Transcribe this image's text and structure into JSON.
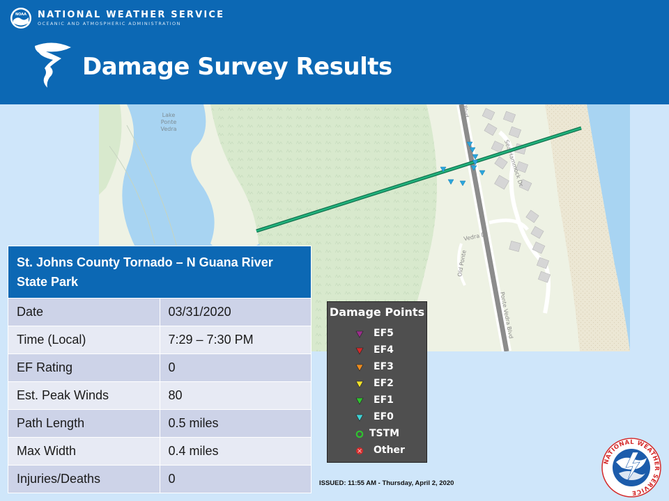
{
  "header": {
    "agency_name": "NATIONAL WEATHER SERVICE",
    "agency_subtitle": "OCEANIC AND ATMOSPHERIC ADMINISTRATION",
    "title": "Damage Survey Results",
    "noaa_badge": "NOAA"
  },
  "map": {
    "labels": {
      "lake_line1": "Lake",
      "lake_line2": "Ponte",
      "lake_line3": "Vedra",
      "hammock_dr": "Sea Hammock Dr",
      "vedra_dr": "Vedra Dr",
      "old_ponte": "Old Ponte",
      "ponte_vedra_blvd": "Ponte Vedra Blvd",
      "blvd_top": "Blvd"
    },
    "colors": {
      "water": "#a8d4f2",
      "land": "#eef2e4",
      "forest": "#cfe4c4",
      "beach": "#ece7d4",
      "track": "#1a9f6e",
      "road": "#8c8c8c",
      "damage_point": "#2aa6dc"
    }
  },
  "summary": {
    "title": "St. Johns County Tornado – N Guana River State Park",
    "rows": [
      {
        "label": "Date",
        "value": "03/31/2020"
      },
      {
        "label": "Time (Local)",
        "value": "7:29 – 7:30 PM"
      },
      {
        "label": "EF Rating",
        "value": "0"
      },
      {
        "label": "Est. Peak Winds",
        "value": "80"
      },
      {
        "label": "Path Length",
        "value": "0.5 miles"
      },
      {
        "label": "Max Width",
        "value": "0.4 miles"
      },
      {
        "label": "Injuries/Deaths",
        "value": "0"
      }
    ]
  },
  "legend": {
    "title": "Damage Points",
    "items": [
      {
        "label": "EF5",
        "color": "#9b2d8c",
        "shape": "triangle-down"
      },
      {
        "label": "EF4",
        "color": "#d42a2a",
        "shape": "triangle-down"
      },
      {
        "label": "EF3",
        "color": "#ef8c1e",
        "shape": "triangle-down"
      },
      {
        "label": "EF2",
        "color": "#f2e22a",
        "shape": "triangle-down"
      },
      {
        "label": "EF1",
        "color": "#2fc42f",
        "shape": "triangle-down"
      },
      {
        "label": "EF0",
        "color": "#3fd3d6",
        "shape": "triangle-down"
      },
      {
        "label": "TSTM",
        "color": "#2fc42f",
        "shape": "ring"
      },
      {
        "label": "Other",
        "color": "#d42a2a",
        "shape": "cross-circle"
      }
    ]
  },
  "footer": {
    "issued": "ISSUED: 11:55 AM - Thursday, April 2, 2020",
    "nws_seal_text": "NATIONAL WEATHER SERVICE"
  }
}
